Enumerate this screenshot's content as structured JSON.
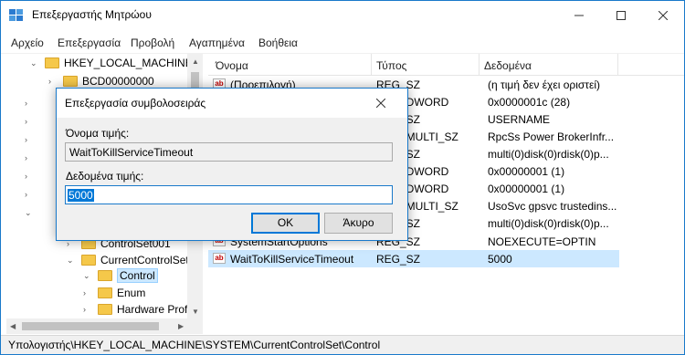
{
  "window": {
    "title": "Επεξεργαστής Μητρώου"
  },
  "menu": [
    "Αρχείο",
    "Επεξεργασία",
    "Προβολή",
    "Αγαπημένα",
    "Βοήθεια"
  ],
  "tree": {
    "items": [
      {
        "label": "HKEY_LOCAL_MACHINE",
        "expander": "⌄"
      },
      {
        "label": "BCD00000000",
        "expander": "›"
      },
      {
        "label": "ControlSet001",
        "expander": "›"
      },
      {
        "label": "CurrentControlSet",
        "expander": "⌄"
      },
      {
        "label": "Control",
        "expander": "⌄"
      },
      {
        "label": "Enum",
        "expander": "›"
      },
      {
        "label": "Hardware Prof",
        "expander": "›"
      }
    ]
  },
  "list": {
    "headers": {
      "name": "Όνομα",
      "type": "Τύπος",
      "data": "Δεδομένα"
    },
    "rows": [
      {
        "name": "(Προεπιλογή)",
        "type": "REG_SZ",
        "data": "(η τιμή δεν έχει οριστεί)"
      },
      {
        "name": "",
        "type": "REG_DWORD",
        "data": "0x0000001c (28)"
      },
      {
        "name": "",
        "type": "REG_SZ",
        "data": "USERNAME"
      },
      {
        "name": "",
        "type": "REG_MULTI_SZ",
        "data": "RpcSs Power BrokerInfr..."
      },
      {
        "name": "",
        "type": "REG_SZ",
        "data": "multi(0)disk(0)rdisk(0)p..."
      },
      {
        "name": "",
        "type": "REG_DWORD",
        "data": "0x00000001 (1)"
      },
      {
        "name": "",
        "type": "REG_DWORD",
        "data": "0x00000001 (1)"
      },
      {
        "name": "",
        "type": "REG_MULTI_SZ",
        "data": "UsoSvc gpsvc trustedins..."
      },
      {
        "name": "",
        "type": "REG_SZ",
        "data": "multi(0)disk(0)rdisk(0)p..."
      },
      {
        "name": "SystemStartOptions",
        "type": "REG_SZ",
        "data": " NOEXECUTE=OPTIN"
      },
      {
        "name": "WaitToKillServiceTimeout",
        "type": "REG_SZ",
        "data": "5000"
      }
    ]
  },
  "status": {
    "path": "Υπολογιστής\\HKEY_LOCAL_MACHINE\\SYSTEM\\CurrentControlSet\\Control"
  },
  "dialog": {
    "title": "Επεξεργασία συμβολοσειράς",
    "name_label": "Όνομα τιμής:",
    "name_value": "WaitToKillServiceTimeout",
    "data_label": "Δεδομένα τιμής:",
    "data_value": "5000",
    "ok_label": "OK",
    "cancel_label": "Άκυρο"
  }
}
